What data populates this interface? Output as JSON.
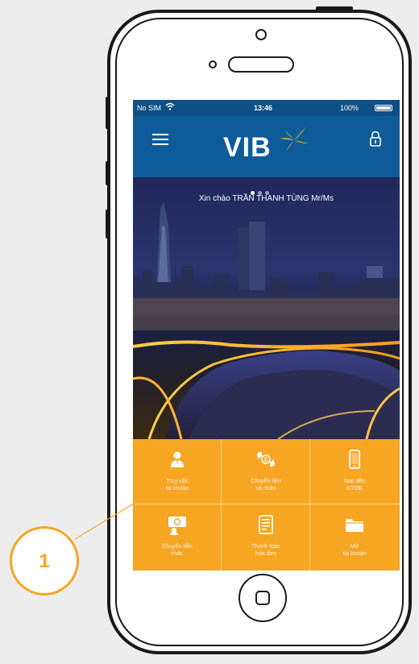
{
  "status_bar": {
    "carrier": "No SIM",
    "time": "13:46",
    "battery": "100%"
  },
  "header": {
    "logo": "VIB",
    "menu_icon": "menu-icon",
    "lock_icon": "lock-icon"
  },
  "carousel": {
    "pages": 3,
    "active": 1
  },
  "greeting": "Xin chào TRẦN THANH TÙNG Mr/Ms",
  "tiles": [
    {
      "label": "Truy vấn\ntài khoản",
      "icon": "account-query-icon"
    },
    {
      "label": "Chuyển tiền\ncá nhân",
      "icon": "personal-transfer-icon"
    },
    {
      "label": "Nạp tiền\nĐTDĐ",
      "icon": "mobile-topup-icon"
    },
    {
      "label": "Chuyển tiền\nkhác",
      "icon": "other-transfer-icon"
    },
    {
      "label": "Thanh toán\nhóa đơn",
      "icon": "bill-payment-icon"
    },
    {
      "label": "Mở\ntài khoản",
      "icon": "open-account-icon"
    }
  ],
  "callout": {
    "number": "1"
  },
  "colors": {
    "brand_blue": "#0e5b9a",
    "tile_orange": "#f6a623",
    "logo_yellow": "#f7c21b"
  }
}
